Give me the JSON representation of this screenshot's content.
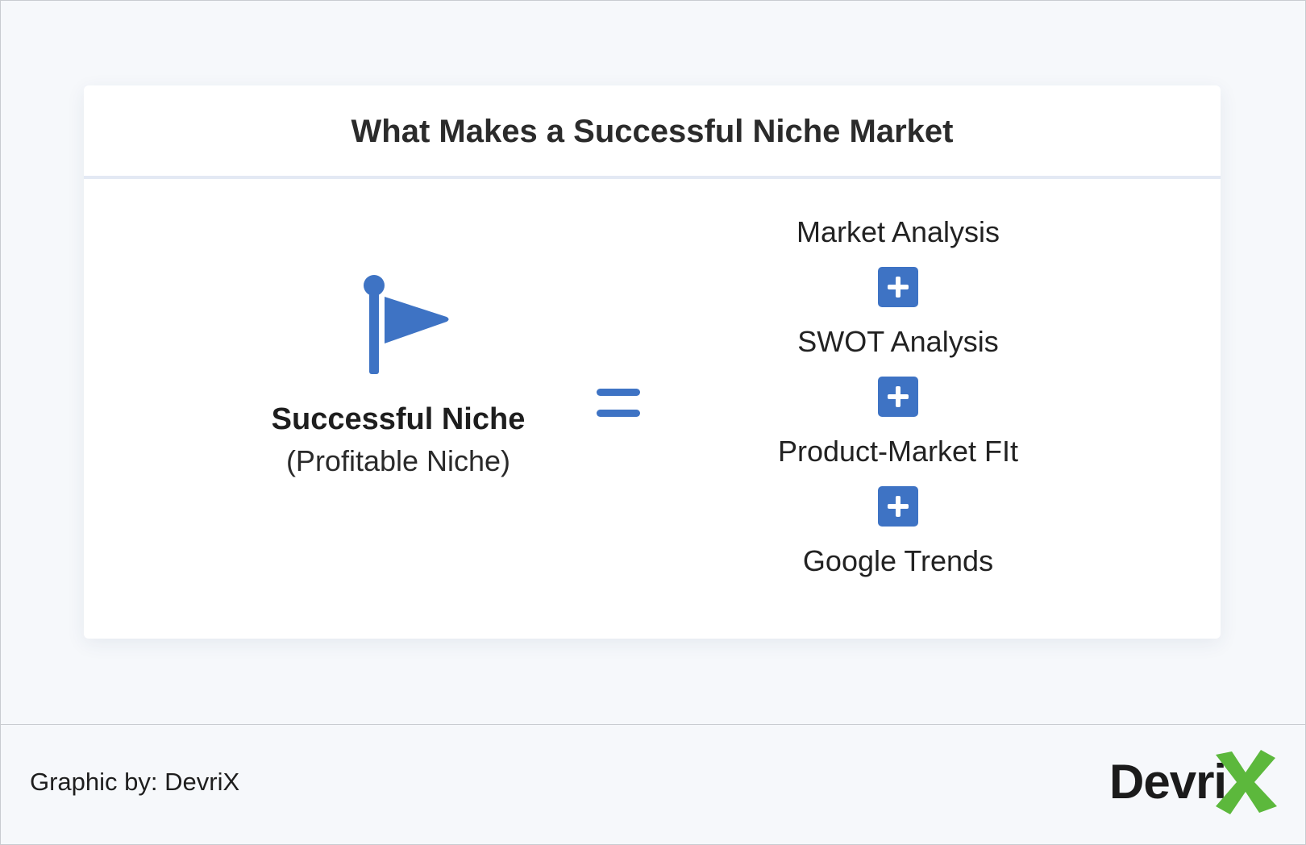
{
  "card": {
    "title": "What Makes a Successful Niche Market"
  },
  "left": {
    "icon": "flag-icon",
    "title": "Successful Niche",
    "subtitle": "(Profitable Niche)"
  },
  "operator": "=",
  "formula": {
    "terms": [
      "Market Analysis",
      "SWOT Analysis",
      "Product-Market FIt",
      "Google Trends"
    ],
    "plus_icon": "plus-icon"
  },
  "footer": {
    "credit": "Graphic by: DevriX",
    "logo_text": "Devri"
  },
  "colors": {
    "accent": "#3e73c4",
    "logo_green": "#5cb83c",
    "background": "#f6f8fb",
    "card": "#ffffff"
  }
}
